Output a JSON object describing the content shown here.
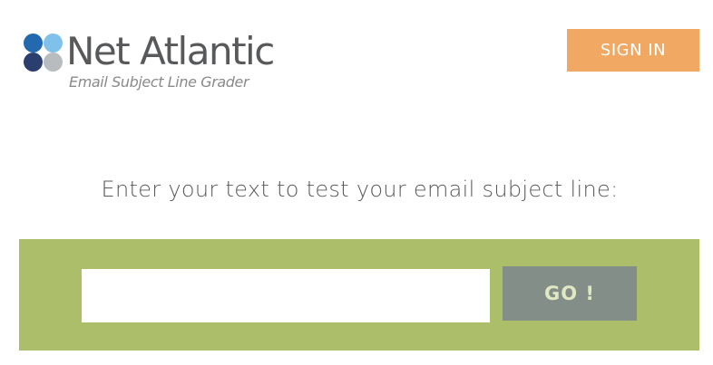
{
  "header": {
    "logo": {
      "name": "Net Atlantic",
      "tagline": "Email Subject Line Grader",
      "dot_colors": {
        "top_left": "#2269b0",
        "top_right": "#7fc1ea",
        "bottom_left": "#2b3f6e",
        "bottom_right": "#b9bcbf"
      },
      "name_color": "#58595b",
      "tagline_color": "#8a8a8a"
    },
    "sign_in": {
      "label": "SIGN IN",
      "bg_color": "#f0a862",
      "text_color": "#ffffff"
    }
  },
  "main": {
    "prompt": "Enter your text to test your email subject line:",
    "prompt_color": "#5a5a5a",
    "form": {
      "band_color": "#adbe6b",
      "input": {
        "value": "",
        "placeholder": ""
      },
      "go_button": {
        "label": "GO !",
        "bg_color": "#838e89",
        "text_color": "#dfe8c0"
      }
    }
  }
}
